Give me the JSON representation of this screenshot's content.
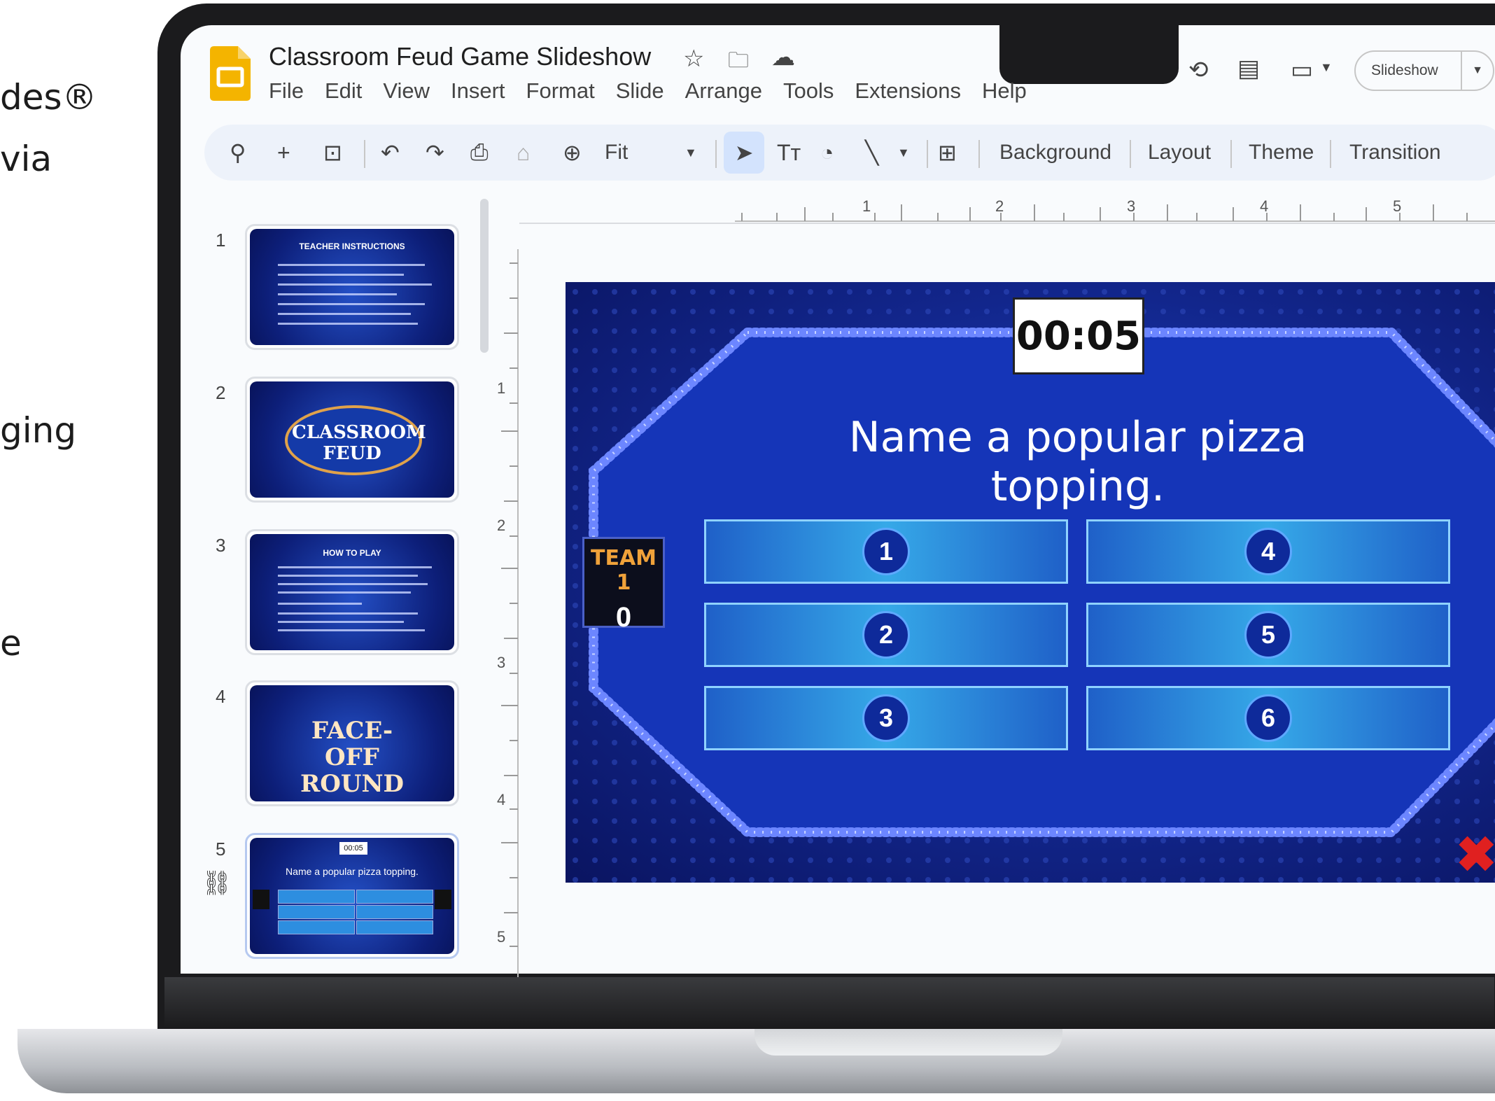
{
  "marketing": {
    "line1": "des®",
    "line2": "via",
    "line3": "ging",
    "line4": "e"
  },
  "app": {
    "title": "Classroom Feud Game Slideshow",
    "menu": [
      "File",
      "Edit",
      "View",
      "Insert",
      "Format",
      "Slide",
      "Arrange",
      "Tools",
      "Extensions",
      "Help"
    ],
    "slideshow_label": "Slideshow"
  },
  "toolbar": {
    "zoom_label": "Fit",
    "background_label": "Background",
    "layout_label": "Layout",
    "theme_label": "Theme",
    "transition_label": "Transition"
  },
  "rulers": {
    "horizontal": [
      "1",
      "2",
      "3",
      "4",
      "5"
    ],
    "vertical": [
      "1",
      "2",
      "3",
      "4",
      "5"
    ]
  },
  "filmstrip": [
    {
      "num": "1",
      "title": "TEACHER INSTRUCTIONS"
    },
    {
      "num": "2",
      "title": "CLASSROOM FEUD"
    },
    {
      "num": "3",
      "title": "HOW TO PLAY"
    },
    {
      "num": "4",
      "title": "FACE-OFF ROUND"
    },
    {
      "num": "5",
      "title": "Name a popular pizza topping.",
      "timer": "00:05"
    }
  ],
  "slide": {
    "timer": "00:05",
    "question": "Name a popular pizza topping.",
    "team_name": "TEAM 1",
    "team_score": "0",
    "answers": [
      "1",
      "2",
      "3",
      "4",
      "5",
      "6"
    ],
    "strike": "✖"
  },
  "colors": {
    "slide_bg": "#12268c",
    "answer_border": "#8fd2ff",
    "team_label": "#f0a23a"
  }
}
